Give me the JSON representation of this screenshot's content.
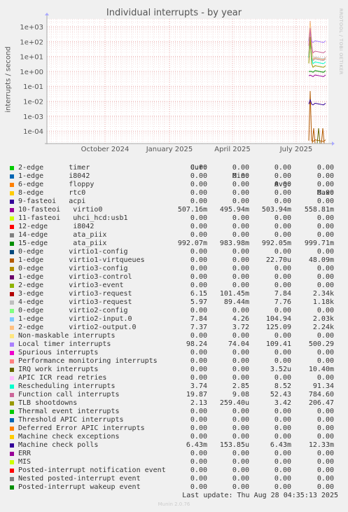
{
  "chart_data": {
    "type": "line",
    "title": "Individual interrupts - by year",
    "ylabel": "interrupts / second",
    "yscale": "log",
    "yticks": [
      "1e+03",
      "1e+02",
      "1e+01",
      "1e+00",
      "1e-01",
      "1e-02",
      "1e-03",
      "1e-04"
    ],
    "xticks": [
      "October 2024",
      "January 2025",
      "April 2025",
      "July 2025"
    ],
    "grid": true,
    "columns": [
      "Cur:",
      "Min:",
      "Avg:",
      "Max:"
    ],
    "series": [
      {
        "name": "2-edge      timer",
        "color": "#00cc00",
        "cur": "0.00",
        "min": "0.00",
        "avg": "0.00",
        "max": "0.00"
      },
      {
        "name": "1-edge      i8042",
        "color": "#0066b3",
        "cur": "0.00",
        "min": "0.00",
        "avg": "0.00",
        "max": "0.00"
      },
      {
        "name": "6-edge      floppy",
        "color": "#ff8000",
        "cur": "0.00",
        "min": "0.00",
        "avg": "0.00",
        "max": "0.00"
      },
      {
        "name": "8-edge      rtc0",
        "color": "#ffcc00",
        "cur": "0.00",
        "min": "0.00",
        "avg": "0.00",
        "max": "0.00"
      },
      {
        "name": "9-fasteoi   acpi",
        "color": "#330099",
        "cur": "0.00",
        "min": "0.00",
        "avg": "0.00",
        "max": "0.00"
      },
      {
        "name": "10-fasteoi   virtio0",
        "color": "#990099",
        "cur": "507.16m",
        "min": "495.94m",
        "avg": "503.94m",
        "max": "558.81m"
      },
      {
        "name": "11-fasteoi   uhci_hcd:usb1",
        "color": "#ccff00",
        "cur": "0.00",
        "min": "0.00",
        "avg": "0.00",
        "max": "0.00"
      },
      {
        "name": "12-edge      i8042",
        "color": "#ff0000",
        "cur": "0.00",
        "min": "0.00",
        "avg": "0.00",
        "max": "0.00"
      },
      {
        "name": "14-edge      ata_piix",
        "color": "#808080",
        "cur": "0.00",
        "min": "0.00",
        "avg": "0.00",
        "max": "0.00"
      },
      {
        "name": "15-edge      ata_piix",
        "color": "#008f00",
        "cur": "992.07m",
        "min": "983.98m",
        "avg": "992.05m",
        "max": "999.71m"
      },
      {
        "name": "0-edge      virtio1-config",
        "color": "#00487d",
        "cur": "0.00",
        "min": "0.00",
        "avg": "0.00",
        "max": "0.00"
      },
      {
        "name": "1-edge      virtio1-virtqueues",
        "color": "#b35a00",
        "cur": "0.00",
        "min": "0.00",
        "avg": "22.70u",
        "max": "48.09m"
      },
      {
        "name": "0-edge      virtio3-config",
        "color": "#b38f00",
        "cur": "0.00",
        "min": "0.00",
        "avg": "0.00",
        "max": "0.00"
      },
      {
        "name": "1-edge      virtio3-control",
        "color": "#6b006b",
        "cur": "0.00",
        "min": "0.00",
        "avg": "0.00",
        "max": "0.00"
      },
      {
        "name": "2-edge      virtio3-event",
        "color": "#8fb300",
        "cur": "0.00",
        "min": "0.00",
        "avg": "0.00",
        "max": "0.00"
      },
      {
        "name": "3-edge      virtio3-request",
        "color": "#b30000",
        "cur": "6.15",
        "min": "101.45m",
        "avg": "7.84",
        "max": "2.34k"
      },
      {
        "name": "4-edge      virtio3-request",
        "color": "#bebebe",
        "cur": "5.97",
        "min": "89.44m",
        "avg": "7.76",
        "max": "1.18k"
      },
      {
        "name": "0-edge      virtio2-config",
        "color": "#80ff80",
        "cur": "0.00",
        "min": "0.00",
        "avg": "0.00",
        "max": "0.00"
      },
      {
        "name": "1-edge      virtio2-input.0",
        "color": "#80c9ff",
        "cur": "7.84",
        "min": "4.26",
        "avg": "104.94",
        "max": "2.03k"
      },
      {
        "name": "2-edge      virtio2-output.0",
        "color": "#ffc080",
        "cur": "7.37",
        "min": "3.72",
        "avg": "125.09",
        "max": "2.24k"
      },
      {
        "name": "Non-maskable interrupts",
        "color": "#ffe680",
        "cur": "0.00",
        "min": "0.00",
        "avg": "0.00",
        "max": "0.00"
      },
      {
        "name": "Local timer interrupts",
        "color": "#aa80ff",
        "cur": "98.24",
        "min": "74.04",
        "avg": "109.41",
        "max": "500.29"
      },
      {
        "name": "Spurious interrupts",
        "color": "#ee00cc",
        "cur": "0.00",
        "min": "0.00",
        "avg": "0.00",
        "max": "0.00"
      },
      {
        "name": "Performance monitoring interrupts",
        "color": "#ff8080",
        "cur": "0.00",
        "min": "0.00",
        "avg": "0.00",
        "max": "0.00"
      },
      {
        "name": "IRQ work interrupts",
        "color": "#666600",
        "cur": "0.00",
        "min": "0.00",
        "avg": "3.52u",
        "max": "10.40m"
      },
      {
        "name": "APIC ICR read retries",
        "color": "#ffbfff",
        "cur": "0.00",
        "min": "0.00",
        "avg": "0.00",
        "max": "0.00"
      },
      {
        "name": "Rescheduling interrupts",
        "color": "#00ffcc",
        "cur": "3.74",
        "min": "2.85",
        "avg": "8.52",
        "max": "91.34"
      },
      {
        "name": "Function call interrupts",
        "color": "#cc6699",
        "cur": "19.87",
        "min": "9.08",
        "avg": "52.43",
        "max": "784.60"
      },
      {
        "name": "TLB shootdowns",
        "color": "#999900",
        "cur": "2.13",
        "min": "259.40u",
        "avg": "3.42",
        "max": "206.47"
      },
      {
        "name": "Thermal event interrupts",
        "color": "#00cc00",
        "cur": "0.00",
        "min": "0.00",
        "avg": "0.00",
        "max": "0.00"
      },
      {
        "name": "Threshold APIC interrupts",
        "color": "#0066b3",
        "cur": "0.00",
        "min": "0.00",
        "avg": "0.00",
        "max": "0.00"
      },
      {
        "name": "Deferred Error APIC interrupts",
        "color": "#ff8000",
        "cur": "0.00",
        "min": "0.00",
        "avg": "0.00",
        "max": "0.00"
      },
      {
        "name": "Machine check exceptions",
        "color": "#ffcc00",
        "cur": "0.00",
        "min": "0.00",
        "avg": "0.00",
        "max": "0.00"
      },
      {
        "name": "Machine check polls",
        "color": "#330099",
        "cur": "6.43m",
        "min": "153.85u",
        "avg": "6.43m",
        "max": "12.33m"
      },
      {
        "name": "ERR",
        "color": "#990099",
        "cur": "0.00",
        "min": "0.00",
        "avg": "0.00",
        "max": "0.00"
      },
      {
        "name": "MIS",
        "color": "#ccff00",
        "cur": "0.00",
        "min": "0.00",
        "avg": "0.00",
        "max": "0.00"
      },
      {
        "name": "Posted-interrupt notification event",
        "color": "#ff0000",
        "cur": "0.00",
        "min": "0.00",
        "avg": "0.00",
        "max": "0.00"
      },
      {
        "name": "Nested posted-interrupt event",
        "color": "#808080",
        "cur": "0.00",
        "min": "0.00",
        "avg": "0.00",
        "max": "0.00"
      },
      {
        "name": "Posted-interrupt wakeup event",
        "color": "#008f00",
        "cur": "0.00",
        "min": "0.00",
        "avg": "0.00",
        "max": "0.00"
      }
    ]
  },
  "last_update": "Last update: Thu Aug 28 04:35:13 2025",
  "watermark": "RRDTOOL / TOBI OETIKER",
  "munin_version": "Munin 2.0.76"
}
